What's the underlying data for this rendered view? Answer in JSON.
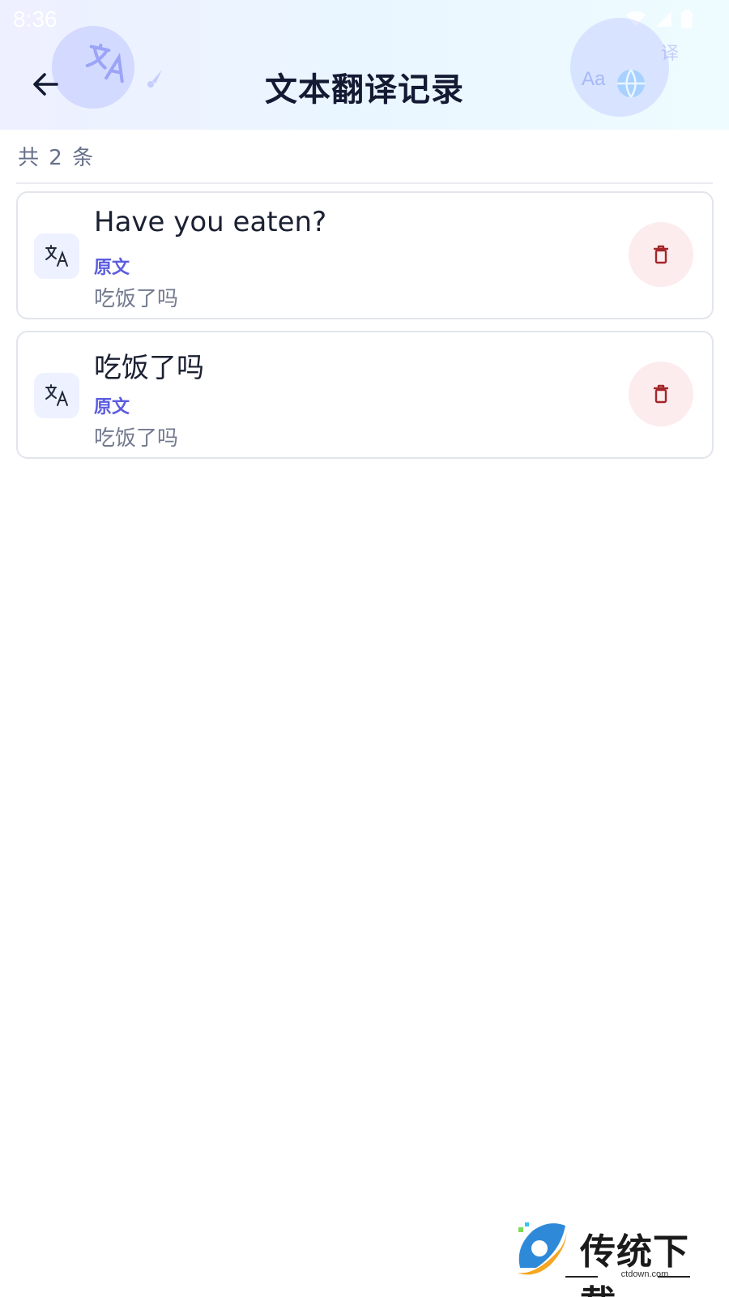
{
  "status_bar": {
    "time": "8:36"
  },
  "header": {
    "title": "文本翻译记录",
    "deco_char": "译",
    "deco_aa": "Aa"
  },
  "summary": {
    "count_text": "共 2 条"
  },
  "records": [
    {
      "translation": "Have you eaten?",
      "source_label": "原文",
      "source_text": "吃饭了吗"
    },
    {
      "translation": "吃饭了吗",
      "source_label": "原文",
      "source_text": "吃饭了吗"
    }
  ],
  "colors": {
    "accent": "#5b5ce0",
    "delete_bg": "#fdecee",
    "delete_icon": "#a3262a",
    "title": "#141a33"
  },
  "icons": {
    "back": "arrow-left-icon",
    "record": "translate-icon",
    "delete": "trash-icon"
  },
  "watermark": {
    "brand": "传统下载",
    "domain": "ctdown.com"
  }
}
